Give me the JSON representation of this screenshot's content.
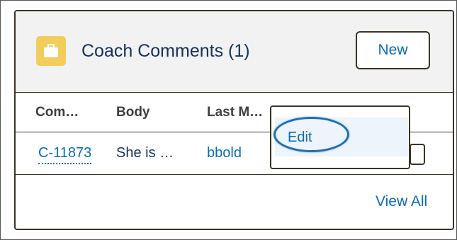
{
  "card": {
    "title": "Coach Comments (1)",
    "icon": "briefcase-icon",
    "icon_color": "#f2cd5b",
    "new_label": "New"
  },
  "table": {
    "columns": [
      "Com…",
      "Body",
      "Last M…"
    ],
    "rows": [
      {
        "name": "C-11873",
        "body": "She is …",
        "last_modified": "bbold"
      }
    ]
  },
  "row_menu": {
    "items": [
      "Edit"
    ]
  },
  "footer": {
    "view_all_label": "View All"
  },
  "colors": {
    "link": "#0b6bb5",
    "header_bg": "#f2f2f2",
    "highlight_ring": "#1e6fb4"
  }
}
